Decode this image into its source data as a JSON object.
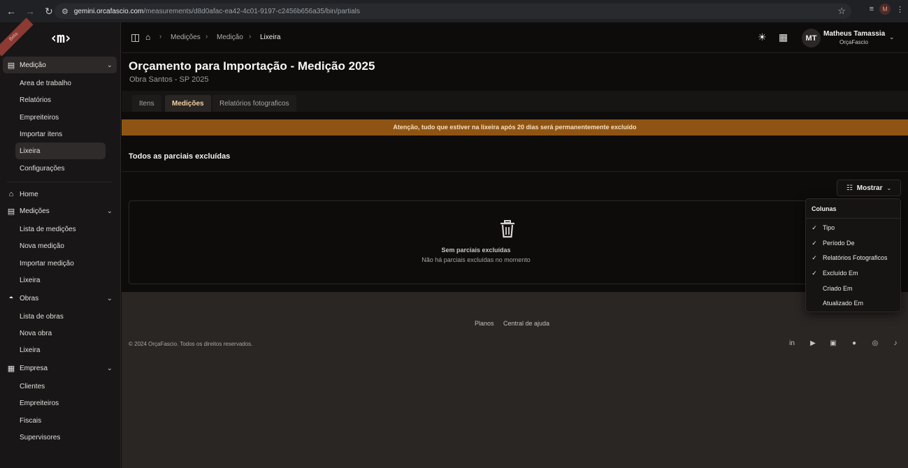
{
  "browser": {
    "url_host": "gemini.orcafascio.com",
    "url_path": "/measurements/d8d0afac-ea42-4c01-9197-c2456b656a35/bin/partials",
    "profile_initial": "M"
  },
  "sidebar": {
    "beta_label": "Beta",
    "logo_text": "‹m›",
    "medicao_group": {
      "label": "Medição",
      "items": [
        "Area de trabalho",
        "Relatórios",
        "Empreiteiros",
        "Importar itens",
        "Lixeira",
        "Configurações"
      ]
    },
    "home_label": "Home",
    "medicoes_group": {
      "label": "Medições",
      "items": [
        "Lista de medições",
        "Nova medição",
        "Importar medição",
        "Lixeira"
      ]
    },
    "obras_group": {
      "label": "Obras",
      "items": [
        "Lista de obras",
        "Nova obra",
        "Lixeira"
      ]
    },
    "empresa_group": {
      "label": "Empresa",
      "items": [
        "Clientes",
        "Empreiteiros",
        "Fiscais",
        "Supervisores"
      ]
    }
  },
  "topbar": {
    "breadcrumbs": [
      "Medições",
      "Medição",
      "Lixeira"
    ],
    "user_initials": "MT",
    "user_name": "Matheus Tamassia",
    "user_org": "OrçaFascio"
  },
  "page": {
    "title": "Orçamento para Importação - Medição 2025",
    "subtitle": "Obra Santos - SP 2025",
    "tabs": [
      "Itens",
      "Medições",
      "Relatórios fotograficos"
    ],
    "active_tab": "Medições",
    "banner": "Atenção, tudo que estiver na lixeira após 20 dias será permanentemente excluído",
    "section_title": "Todos as parciais excluídas",
    "show_button": "Mostrar",
    "empty_title": "Sem parciais excluídas",
    "empty_desc": "Não há parciais excluídas no momento"
  },
  "columns_menu": {
    "header": "Colunas",
    "items": [
      {
        "label": "Tipo",
        "checked": true
      },
      {
        "label": "Período De",
        "checked": true
      },
      {
        "label": "Relatórios Fotograficos",
        "checked": true
      },
      {
        "label": "Excluído Em",
        "checked": true
      },
      {
        "label": "Criado Em",
        "checked": false
      },
      {
        "label": "Atualizado Em",
        "checked": false
      }
    ]
  },
  "footer": {
    "links": [
      "Planos",
      "Central de ajuda"
    ],
    "copyright": "© 2024 OrçaFascio. Todos os direitos reservados.",
    "social_icons": [
      "linkedin-icon",
      "play-icon",
      "youtube-icon",
      "facebook-icon",
      "instagram-icon",
      "tiktok-icon"
    ]
  },
  "colors": {
    "banner_bg": "#8f5414",
    "active_tab_text": "#f4d2a6",
    "sidebar_bg": "#181616"
  }
}
